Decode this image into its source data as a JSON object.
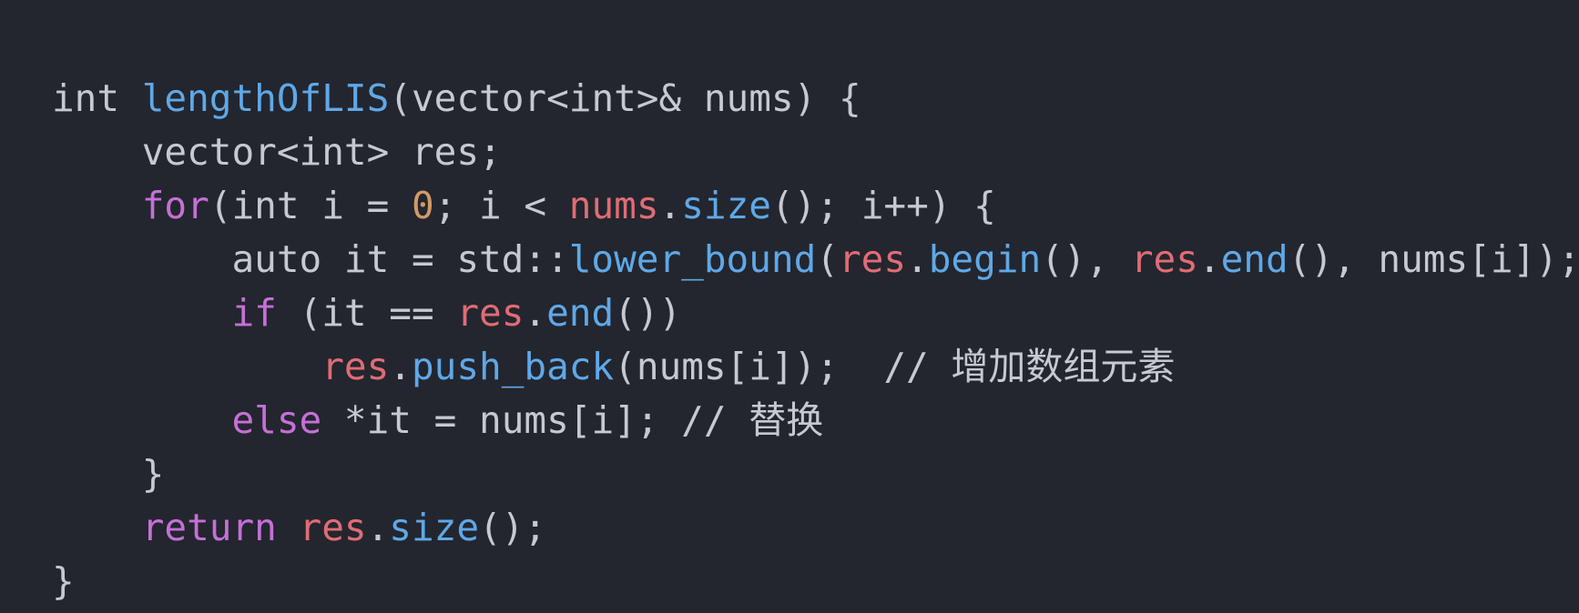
{
  "theme": {
    "background": "#23262e",
    "colors": {
      "plain": "#c5c9d1",
      "keyword": "#c66fd8",
      "function": "#5fa8e8",
      "number": "#d19a66",
      "variable": "#e06c75",
      "comment": "#c5c9d1"
    }
  },
  "code": {
    "language": "C++",
    "lines": [
      {
        "tokens": [
          {
            "t": "int ",
            "k": "plain"
          },
          {
            "t": "lengthOfLIS",
            "k": "function"
          },
          {
            "t": "(vector<int>& nums) {",
            "k": "plain"
          }
        ]
      },
      {
        "tokens": [
          {
            "t": "    vector<int> res;",
            "k": "plain"
          }
        ]
      },
      {
        "tokens": [
          {
            "t": "    ",
            "k": "plain"
          },
          {
            "t": "for",
            "k": "keyword"
          },
          {
            "t": "(int i = ",
            "k": "plain"
          },
          {
            "t": "0",
            "k": "number"
          },
          {
            "t": "; i < ",
            "k": "plain"
          },
          {
            "t": "nums",
            "k": "variable"
          },
          {
            "t": ".",
            "k": "plain"
          },
          {
            "t": "size",
            "k": "function"
          },
          {
            "t": "(); i++) {",
            "k": "plain"
          }
        ]
      },
      {
        "tokens": [
          {
            "t": "        auto it = std::",
            "k": "plain"
          },
          {
            "t": "lower_bound",
            "k": "function"
          },
          {
            "t": "(",
            "k": "plain"
          },
          {
            "t": "res",
            "k": "variable"
          },
          {
            "t": ".",
            "k": "plain"
          },
          {
            "t": "begin",
            "k": "function"
          },
          {
            "t": "(), ",
            "k": "plain"
          },
          {
            "t": "res",
            "k": "variable"
          },
          {
            "t": ".",
            "k": "plain"
          },
          {
            "t": "end",
            "k": "function"
          },
          {
            "t": "(), nums[i]);",
            "k": "plain"
          }
        ]
      },
      {
        "tokens": [
          {
            "t": "        ",
            "k": "plain"
          },
          {
            "t": "if",
            "k": "keyword"
          },
          {
            "t": " (it == ",
            "k": "plain"
          },
          {
            "t": "res",
            "k": "variable"
          },
          {
            "t": ".",
            "k": "plain"
          },
          {
            "t": "end",
            "k": "function"
          },
          {
            "t": "())",
            "k": "plain"
          }
        ]
      },
      {
        "tokens": [
          {
            "t": "            ",
            "k": "plain"
          },
          {
            "t": "res",
            "k": "variable"
          },
          {
            "t": ".",
            "k": "plain"
          },
          {
            "t": "push_back",
            "k": "function"
          },
          {
            "t": "(nums[i]);  // 增加数组元素",
            "k": "plain"
          }
        ]
      },
      {
        "tokens": [
          {
            "t": "        ",
            "k": "plain"
          },
          {
            "t": "else",
            "k": "keyword"
          },
          {
            "t": " *it = nums[i]; // 替换",
            "k": "plain"
          }
        ]
      },
      {
        "tokens": [
          {
            "t": "    }",
            "k": "plain"
          }
        ]
      },
      {
        "tokens": [
          {
            "t": "    ",
            "k": "plain"
          },
          {
            "t": "return",
            "k": "keyword"
          },
          {
            "t": " ",
            "k": "plain"
          },
          {
            "t": "res",
            "k": "variable"
          },
          {
            "t": ".",
            "k": "plain"
          },
          {
            "t": "size",
            "k": "function"
          },
          {
            "t": "();",
            "k": "plain"
          }
        ]
      },
      {
        "tokens": [
          {
            "t": "}",
            "k": "plain"
          }
        ]
      }
    ]
  }
}
